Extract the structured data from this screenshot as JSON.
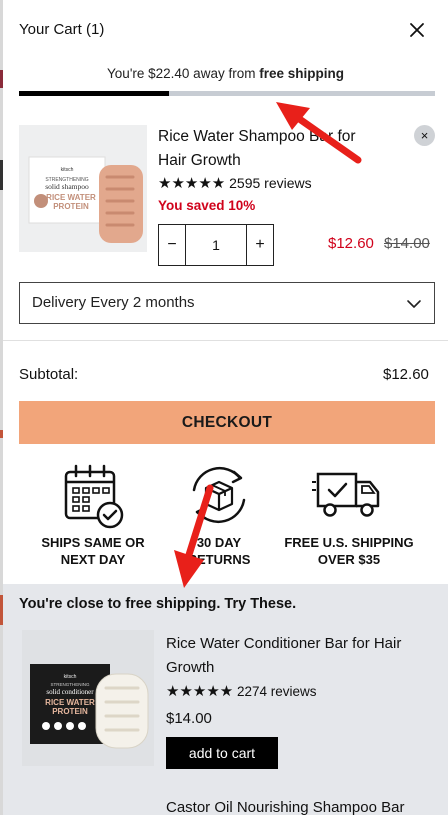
{
  "header": {
    "title": "Your Cart (1)",
    "close_icon": "close-icon"
  },
  "shipping": {
    "message_prefix": "You're $22.40 away from ",
    "message_bold": "free shipping",
    "progress_fraction": 0.36
  },
  "cart_item": {
    "name": "Rice Water Shampoo Bar for Hair Growth",
    "stars": "★★★★★",
    "reviews": "2595 reviews",
    "saved": "You saved 10%",
    "quantity": "1",
    "qty_minus": "−",
    "qty_plus": "+",
    "price_sale": "$12.60",
    "price_original": "$14.00",
    "remove_symbol": "×",
    "image_text": {
      "brand": "kitsch",
      "line1": "STRENGTHENING",
      "line2": "solid shampoo",
      "line3": "RICE WATER",
      "line4": "PROTEIN"
    }
  },
  "delivery": {
    "label": "Delivery Every 2 months"
  },
  "subtotal": {
    "label": "Subtotal:",
    "value": "$12.60"
  },
  "checkout": {
    "label": "CHECKOUT"
  },
  "features": [
    {
      "line1": "SHIPS SAME OR",
      "line2": "NEXT DAY",
      "icon": "calendar-check-icon"
    },
    {
      "line1": "30 DAY",
      "line2": "RETURNS",
      "icon": "box-return-icon"
    },
    {
      "line1": "FREE U.S. SHIPPING",
      "line2": "OVER $35",
      "icon": "delivery-truck-icon"
    }
  ],
  "recommendations": {
    "title": "You're close to free shipping. Try These.",
    "items": [
      {
        "name": "Rice Water Conditioner Bar for Hair Growth",
        "stars": "★★★★★",
        "reviews": "2274 reviews",
        "price": "$14.00",
        "button": "add to cart",
        "image_text": {
          "brand": "kitsch",
          "line1": "STRENGTHENING",
          "line2": "solid conditioner",
          "line3": "RICE WATER",
          "line4": "PROTEIN"
        }
      }
    ],
    "next_item_name": "Castor Oil Nourishing Shampoo Bar"
  },
  "colors": {
    "accent": "#f2a57a",
    "sale_red": "#d0021b",
    "annotation_arrow": "#e8201a",
    "reco_bg": "#e5e7eb"
  }
}
